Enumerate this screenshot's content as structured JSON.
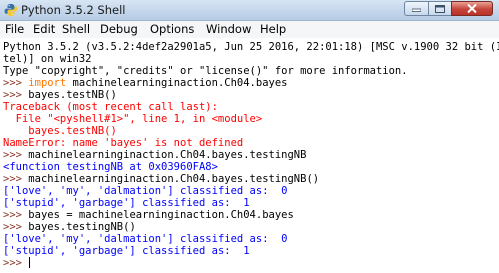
{
  "window": {
    "title": "Python 3.5.2 Shell",
    "icon": "python-icon"
  },
  "menu": [
    "File",
    "Edit",
    "Shell",
    "Debug",
    "Options",
    "Window",
    "Help"
  ],
  "shell": {
    "banner1": "Python 3.5.2 (v3.5.2:4def2a2901a5, Jun 25 2016, 22:01:18) [MSC v.1900 32 bit (I",
    "banner2": "tel)] on win32",
    "banner3": "Type \"copyright\", \"credits\" or \"license()\" for more information.",
    "prompt": ">>> ",
    "l1_kw": "import",
    "l1_rest": " machinelearninginaction.Ch04.bayes",
    "l2_cmd": "bayes.testNB()",
    "tb1": "Traceback (most recent call last):",
    "tb2_a": "  File \"<pyshell#1>\", line 1, in <module>",
    "tb3": "    bayes.testNB()",
    "tb4": "NameError: name 'bayes' is not defined",
    "l3_cmd": "machinelearninginaction.Ch04.bayes.testingNB",
    "out_func": "<function testingNB at 0x03960FA8>",
    "l4_cmd": "machinelearninginaction.Ch04.bayes.testingNB()",
    "res1_list": "['love', 'my', 'dalmation']",
    "res1_tail": " classified as:  0",
    "res2_list": "['stupid', 'garbage']",
    "res2_tail": " classified as:  1",
    "l5_cmd": "bayes = machinelearninginaction.Ch04.bayes",
    "l6_cmd": "bayes.testingNB()",
    "res3_list": "['love', 'my', 'dalmation']",
    "res3_tail": " classified as:  0",
    "res4_list": "['stupid', 'garbage']",
    "res4_tail": " classified as:  1"
  },
  "colors": {
    "prompt": "#8b3a2b",
    "keyword": "#ff7700",
    "string": "#00aa00",
    "stdout": "#0000ff",
    "stderr": "#ff0000"
  }
}
